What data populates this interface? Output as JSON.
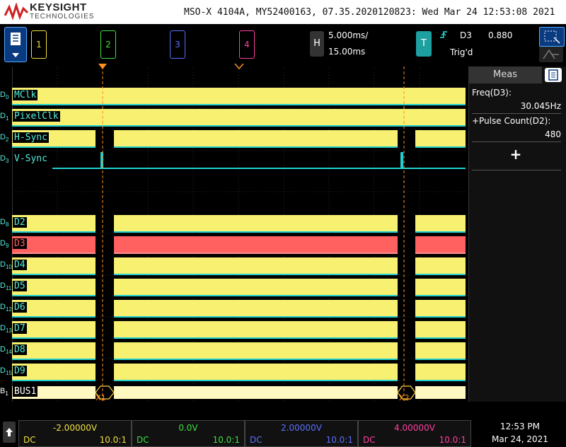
{
  "header": {
    "brand": "KEYSIGHT",
    "brand_sub": "TECHNOLOGIES",
    "instrument_info": "MSO-X 4104A, MY52400163, 07.35.2020120823: Wed Mar 24 12:53:08 2021"
  },
  "channels": [
    {
      "label": "1",
      "color": "#f0e040"
    },
    {
      "label": "2",
      "color": "#40e040"
    },
    {
      "label": "3",
      "color": "#5a70ff"
    },
    {
      "label": "4",
      "color": "#ff40a0"
    }
  ],
  "horizontal": {
    "key": "H",
    "time_per_div": "5.000ms/",
    "delay": "15.00ms"
  },
  "trigger": {
    "key": "T",
    "source": "D3",
    "level": "0.880",
    "status": "Trig'd"
  },
  "signals": [
    {
      "id": "D",
      "sub": "0",
      "name": "MClk"
    },
    {
      "id": "D",
      "sub": "1",
      "name": "PixelClk"
    },
    {
      "id": "D",
      "sub": "2",
      "name": "H-Sync"
    },
    {
      "id": "D",
      "sub": "3",
      "name": "V-Sync"
    },
    {
      "id": "D",
      "sub": "8",
      "name": "D2"
    },
    {
      "id": "D",
      "sub": "9",
      "name": "D3"
    },
    {
      "id": "D",
      "sub": "10",
      "name": "D4"
    },
    {
      "id": "D",
      "sub": "11",
      "name": "D5"
    },
    {
      "id": "D",
      "sub": "12",
      "name": "D6"
    },
    {
      "id": "D",
      "sub": "13",
      "name": "D7"
    },
    {
      "id": "D",
      "sub": "14",
      "name": "D8"
    },
    {
      "id": "D",
      "sub": "15",
      "name": "D9"
    },
    {
      "id": "B",
      "sub": "1",
      "name": "BUS1"
    }
  ],
  "cursors": {
    "x1": "X1",
    "x2": "X2"
  },
  "measurements": {
    "title": "Meas",
    "items": [
      {
        "label": "Freq(D3):",
        "value": "30.045Hz"
      },
      {
        "label": "+Pulse Count(D2):",
        "value": "480"
      }
    ],
    "add": "+"
  },
  "bottom": [
    {
      "value": "-2.00000V",
      "coupling": "DC",
      "probe": "10.0:1",
      "color": "#f0e040"
    },
    {
      "value": "0.0V",
      "coupling": "DC",
      "probe": "10.0:1",
      "color": "#40e040"
    },
    {
      "value": "2.00000V",
      "coupling": "DC",
      "probe": "10.0:1",
      "color": "#5a70ff"
    },
    {
      "value": "4.00000V",
      "coupling": "DC",
      "probe": "10.0:1",
      "color": "#ff40a0"
    }
  ],
  "clock": {
    "time": "12:53 PM",
    "date": "Mar 24, 2021"
  },
  "colors": {
    "digital": "#f8f070",
    "highlight": "#ff6060",
    "trace": "#20d0d0",
    "cursor": "#ff9020",
    "bus": "#fff8c0"
  }
}
